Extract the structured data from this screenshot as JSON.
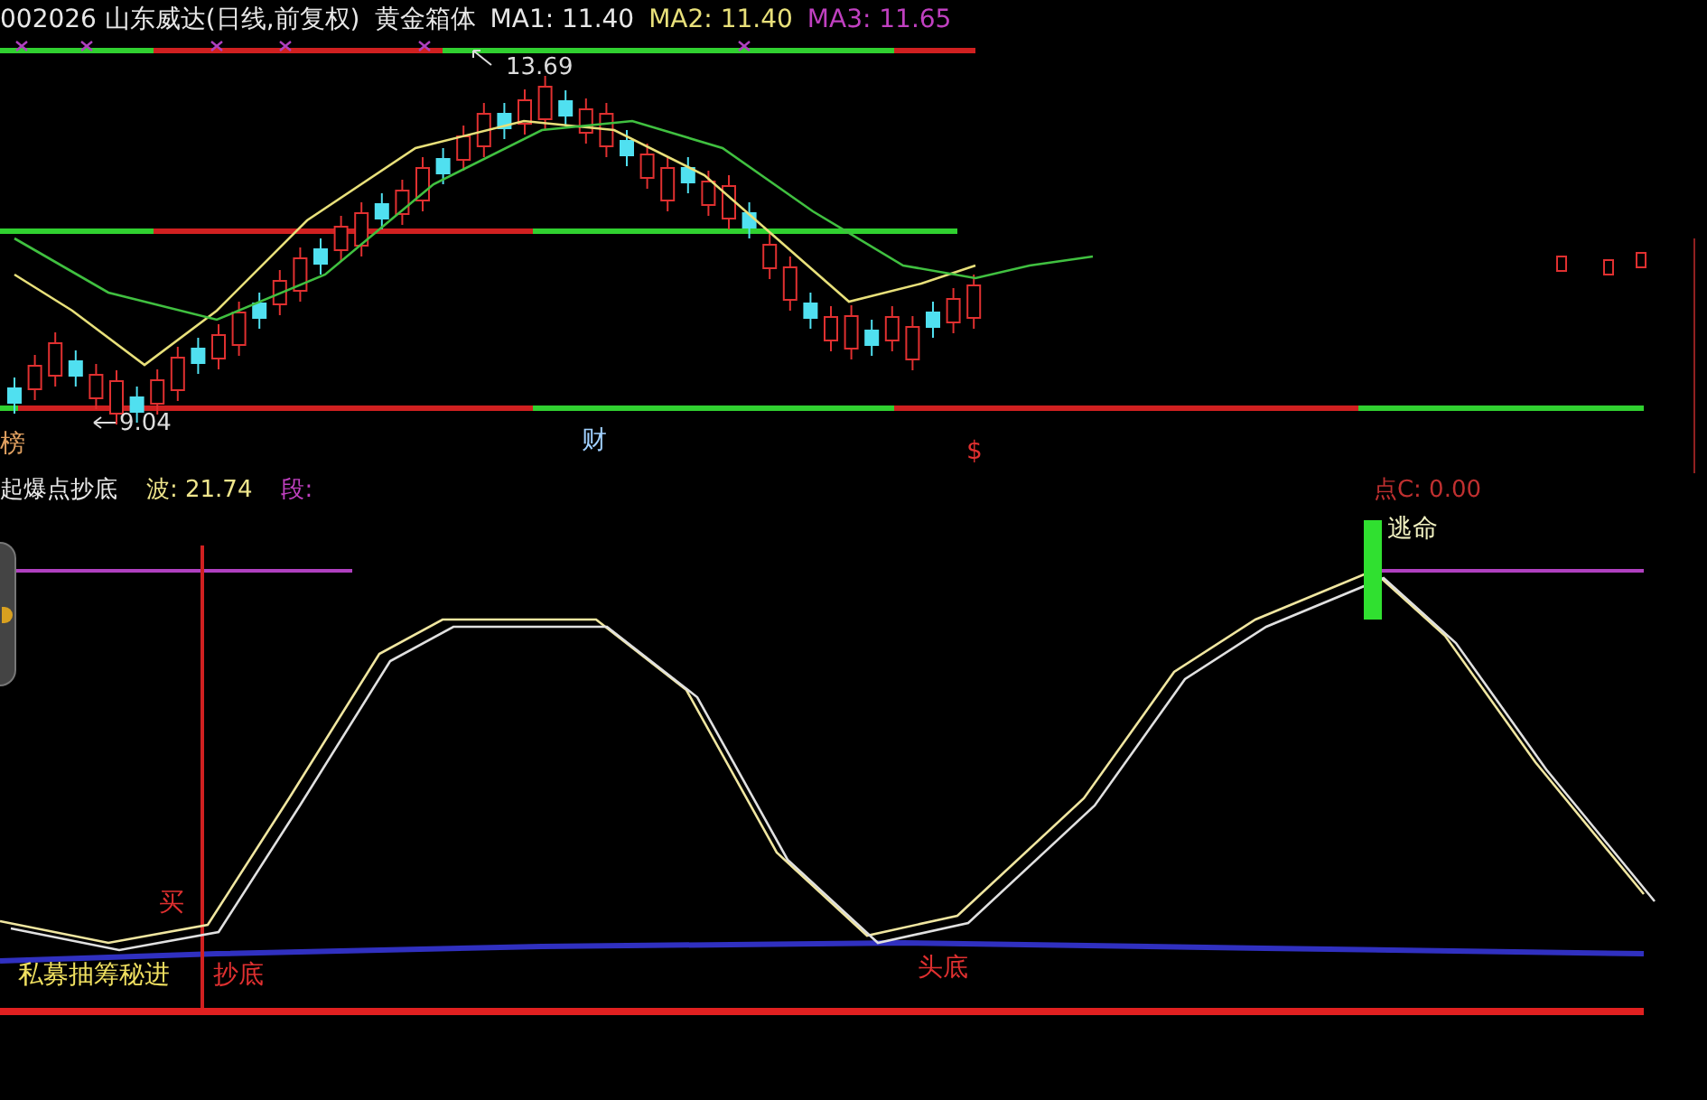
{
  "header": {
    "title": "002026 山东威达(日线,前复权)",
    "indicator": "黄金箱体",
    "ma": [
      {
        "label": "MA1: 11.40",
        "color": "#e8e8e8"
      },
      {
        "label": "MA2: 11.40",
        "color": "#e8e07a"
      },
      {
        "label": "MA3: 11.65",
        "color": "#c040c0"
      }
    ]
  },
  "price_chart": {
    "high_label": "13.69",
    "low_label": "9.04",
    "markers": [
      {
        "text": "榜",
        "color": "#e0a060"
      },
      {
        "text": "财",
        "color": "#a0d0ff"
      },
      {
        "text": "$",
        "color": "#e03030"
      }
    ]
  },
  "indicator_panel": {
    "title": "起爆点抄底",
    "values": [
      {
        "label": "波: 21.74",
        "color": "#f0e68c"
      },
      {
        "label": "段:",
        "color": "#c040c0"
      },
      {
        "label": "点C: 0.00",
        "color": "#c03030"
      }
    ],
    "signals": [
      {
        "text": "逃命",
        "color": "#f0f0c0"
      },
      {
        "text": "买",
        "color": "#e03030"
      },
      {
        "text": "私募抽筹秘进",
        "color": "#f0e060"
      },
      {
        "text": "抄底",
        "color": "#e03030"
      },
      {
        "text": "头底",
        "color": "#e03030"
      }
    ]
  }
}
